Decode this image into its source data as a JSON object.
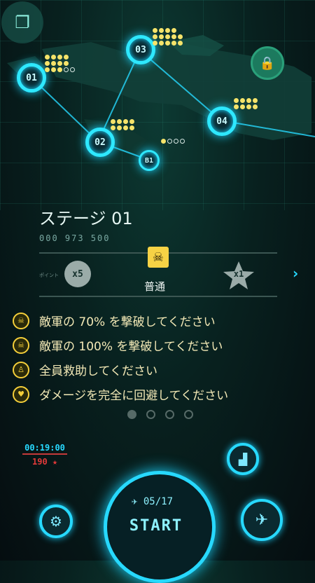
{
  "map": {
    "nodes": [
      {
        "label": "01"
      },
      {
        "label": "02"
      },
      {
        "label": "03"
      },
      {
        "label": "04"
      },
      {
        "label": "B1"
      }
    ]
  },
  "stage": {
    "title": "ステージ 01",
    "score": "000 973 500",
    "point_label": "ポイント",
    "point_multiplier": "x5",
    "difficulty": "普通",
    "star_multiplier": "x1"
  },
  "missions": [
    {
      "icon": "skull-icon",
      "text": "敵軍の 70% を撃破してください"
    },
    {
      "icon": "skull-icon",
      "text": "敵軍の 100% を撃破してください"
    },
    {
      "icon": "rescue-icon",
      "text": "全員救助してください"
    },
    {
      "icon": "shield-heart-icon",
      "text": "ダメージを完全に回避してください"
    }
  ],
  "bottom": {
    "time": "00:19:00",
    "stars": "190",
    "progress": "05/17",
    "start": "START"
  },
  "colors": {
    "accent": "#27d9ff",
    "gold": "#f5cf3a",
    "red": "#e23a3a"
  }
}
